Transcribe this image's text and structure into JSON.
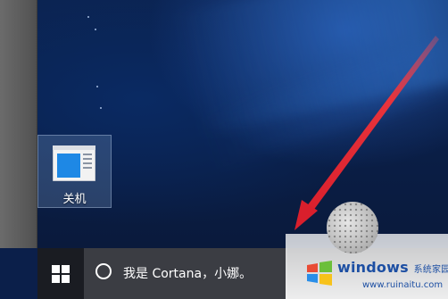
{
  "desktop": {
    "icons": [
      {
        "label": "关机",
        "icon": "shutdown-app-icon"
      }
    ]
  },
  "taskbar": {
    "start_icon": "windows-logo-icon",
    "search": {
      "icon": "cortana-circle-icon",
      "text": "我是 Cortana，小娜。"
    }
  },
  "annotation": {
    "arrow_color": "#e8343c"
  },
  "watermark": {
    "brand": "windows",
    "suffix": "系统家园",
    "site": "www.ruinaitu.com"
  },
  "colors": {
    "desktop_bg": "#0b1f4a",
    "taskbar_bg": "#1a1c22",
    "search_bg": "#3b3d43",
    "icon_blue": "#1e88e5",
    "brand_blue": "#1d4fa3"
  }
}
